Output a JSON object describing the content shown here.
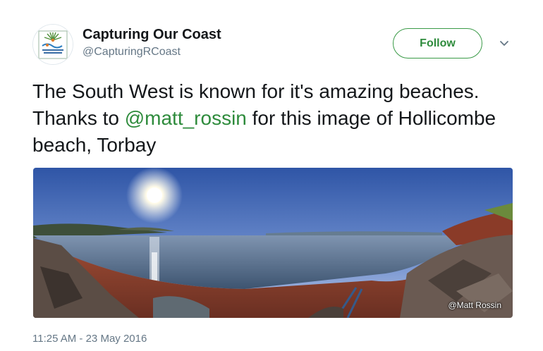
{
  "tweet": {
    "author_name": "Capturing Our Coast",
    "author_handle": "@CapturingRCoast",
    "follow_label": "Follow",
    "text_before": "The South West is known for it's amazing beaches. Thanks to ",
    "mention": "@matt_rossin",
    "text_after": " for this image of Hollicombe beach, Torbay",
    "photo_credit": "@Matt Rossin",
    "timestamp": "11:25 AM - 23 May 2016"
  },
  "icons": {
    "avatar": "capturing-our-coast-logo",
    "menu": "chevron-down-icon"
  },
  "colors": {
    "accent": "#2e8b3c",
    "muted": "#657786",
    "text": "#14171a"
  }
}
